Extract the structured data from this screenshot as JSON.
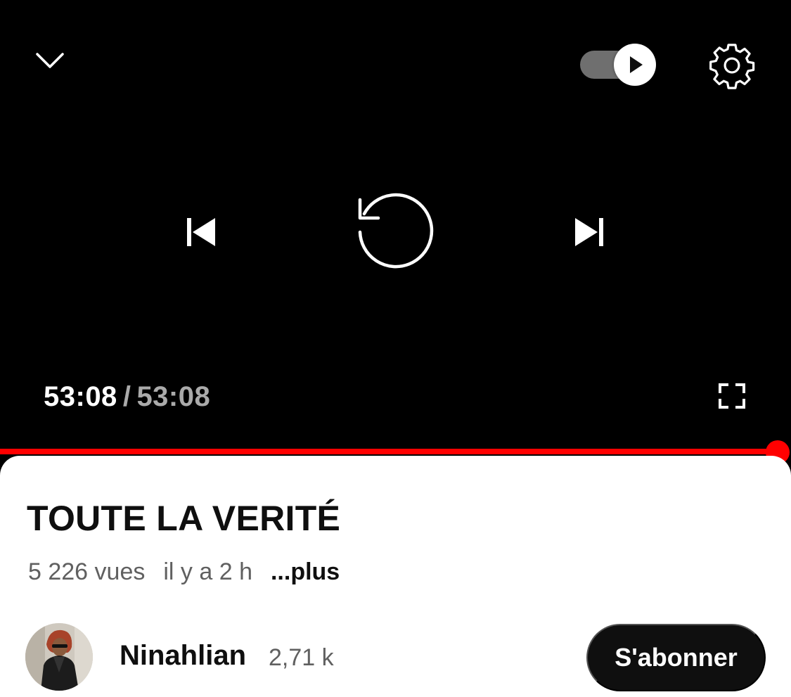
{
  "player": {
    "icons": {
      "collapse": "chevron-down-icon",
      "autoplay": "play-icon",
      "settings": "gear-icon",
      "previous": "skip-previous-icon",
      "replay": "replay-icon",
      "next": "skip-next-icon",
      "fullscreen": "fullscreen-icon"
    },
    "autoplay_on": true,
    "current_time": "53:08",
    "separator": "/",
    "duration": "53:08",
    "progress_percent": 100,
    "colors": {
      "progress": "#ff0000",
      "background": "#000000"
    }
  },
  "video": {
    "title": "TOUTE LA VERITÉ",
    "views": "5 226 vues",
    "age": "il y a 2 h",
    "more_label": "...plus"
  },
  "channel": {
    "name": "Ninahlian",
    "subscribers": "2,71 k",
    "subscribe_label": "S'abonner"
  }
}
